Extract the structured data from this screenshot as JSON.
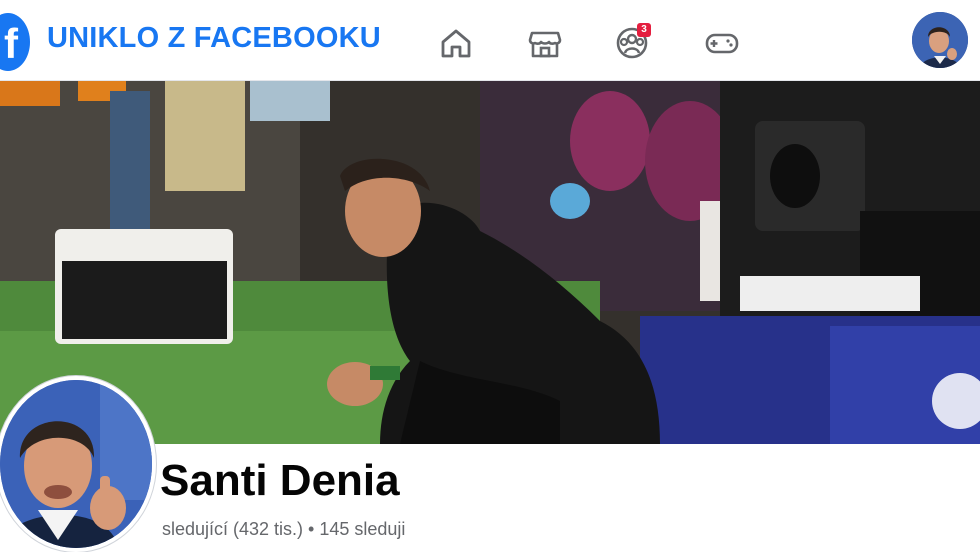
{
  "header": {
    "logo_letter": "f",
    "title": "UNIKLO Z FACEBOOKU",
    "nav": [
      {
        "icon": "home-icon"
      },
      {
        "icon": "marketplace-icon"
      },
      {
        "icon": "groups-icon",
        "badge": "3"
      },
      {
        "icon": "gaming-icon"
      }
    ],
    "avatar_icon": "profile-avatar-small"
  },
  "cover": {
    "icon": "cover-photo"
  },
  "profile": {
    "name": "Santi Denia",
    "stats": "sledující (432 tis.) • 145 sleduji"
  },
  "colors": {
    "brand_blue": "#1877f2",
    "badge_red": "#e41e3f",
    "text_primary": "#050505",
    "text_secondary": "#65676b"
  }
}
